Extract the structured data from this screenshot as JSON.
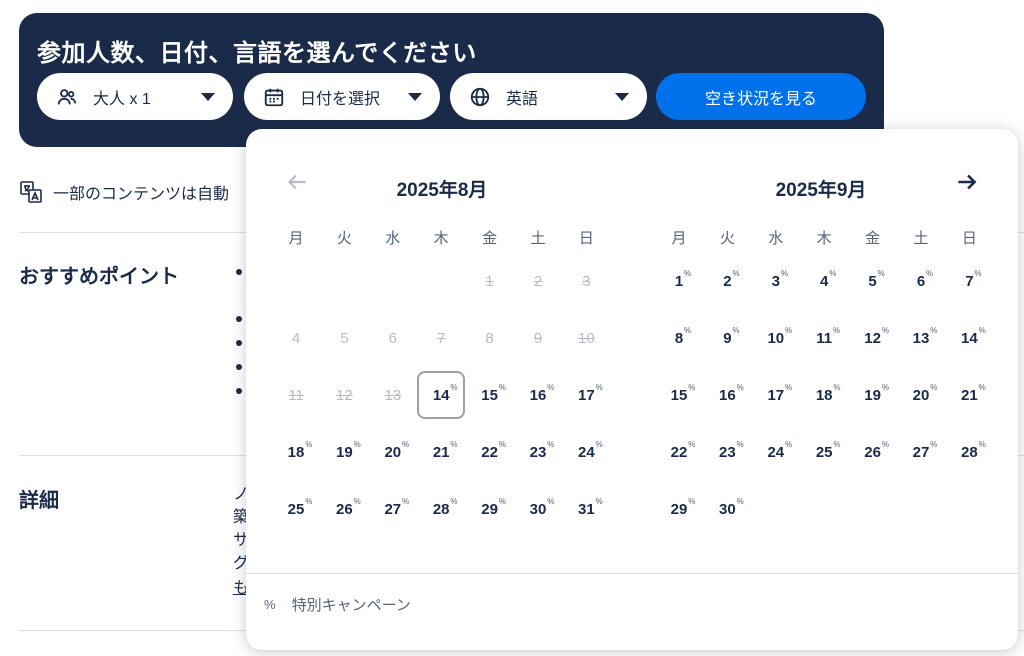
{
  "booking": {
    "title": "参加人数、日付、言語を選んでください",
    "participants_label": "大人 x 1",
    "date_label": "日付を選択",
    "language_label": "英語",
    "check_button": "空き状況を見る"
  },
  "content": {
    "translate_note": "一部のコンテンツは自動",
    "highlights_title": "おすすめポイント",
    "details_title": "詳細",
    "details_fragments": [
      "ノ",
      "築",
      "サ",
      "グ",
      "も"
    ]
  },
  "calendar": {
    "weekdays": [
      "月",
      "火",
      "水",
      "木",
      "金",
      "土",
      "日"
    ],
    "months": [
      {
        "title": "2025年8月",
        "rows": [
          [
            null,
            null,
            null,
            null,
            {
              "d": "1",
              "s": "disabled"
            },
            {
              "d": "2",
              "s": "disabled"
            },
            {
              "d": "3",
              "s": "disabled"
            }
          ],
          [
            {
              "d": "4",
              "s": "inactive"
            },
            {
              "d": "5",
              "s": "inactive"
            },
            {
              "d": "6",
              "s": "inactive"
            },
            {
              "d": "7",
              "s": "disabled"
            },
            {
              "d": "8",
              "s": "inactive"
            },
            {
              "d": "9",
              "s": "disabled"
            },
            {
              "d": "10",
              "s": "disabled"
            }
          ],
          [
            {
              "d": "11",
              "s": "disabled"
            },
            {
              "d": "12",
              "s": "disabled"
            },
            {
              "d": "13",
              "s": "disabled"
            },
            {
              "d": "14",
              "s": "selected"
            },
            {
              "d": "15",
              "s": "avail"
            },
            {
              "d": "16",
              "s": "avail"
            },
            {
              "d": "17",
              "s": "avail"
            }
          ],
          [
            {
              "d": "18",
              "s": "avail"
            },
            {
              "d": "19",
              "s": "avail"
            },
            {
              "d": "20",
              "s": "avail"
            },
            {
              "d": "21",
              "s": "avail"
            },
            {
              "d": "22",
              "s": "avail"
            },
            {
              "d": "23",
              "s": "avail"
            },
            {
              "d": "24",
              "s": "avail"
            }
          ],
          [
            {
              "d": "25",
              "s": "avail"
            },
            {
              "d": "26",
              "s": "avail"
            },
            {
              "d": "27",
              "s": "avail"
            },
            {
              "d": "28",
              "s": "avail"
            },
            {
              "d": "29",
              "s": "avail"
            },
            {
              "d": "30",
              "s": "avail"
            },
            {
              "d": "31",
              "s": "avail"
            }
          ]
        ]
      },
      {
        "title": "2025年9月",
        "rows": [
          [
            {
              "d": "1",
              "s": "avail"
            },
            {
              "d": "2",
              "s": "avail"
            },
            {
              "d": "3",
              "s": "avail"
            },
            {
              "d": "4",
              "s": "avail"
            },
            {
              "d": "5",
              "s": "avail"
            },
            {
              "d": "6",
              "s": "avail"
            },
            {
              "d": "7",
              "s": "avail"
            }
          ],
          [
            {
              "d": "8",
              "s": "avail"
            },
            {
              "d": "9",
              "s": "avail"
            },
            {
              "d": "10",
              "s": "avail"
            },
            {
              "d": "11",
              "s": "avail"
            },
            {
              "d": "12",
              "s": "avail"
            },
            {
              "d": "13",
              "s": "avail"
            },
            {
              "d": "14",
              "s": "avail"
            }
          ],
          [
            {
              "d": "15",
              "s": "avail"
            },
            {
              "d": "16",
              "s": "avail"
            },
            {
              "d": "17",
              "s": "avail"
            },
            {
              "d": "18",
              "s": "avail"
            },
            {
              "d": "19",
              "s": "avail"
            },
            {
              "d": "20",
              "s": "avail"
            },
            {
              "d": "21",
              "s": "avail"
            }
          ],
          [
            {
              "d": "22",
              "s": "avail"
            },
            {
              "d": "23",
              "s": "avail"
            },
            {
              "d": "24",
              "s": "avail"
            },
            {
              "d": "25",
              "s": "avail"
            },
            {
              "d": "26",
              "s": "avail"
            },
            {
              "d": "27",
              "s": "avail"
            },
            {
              "d": "28",
              "s": "avail"
            }
          ],
          [
            {
              "d": "29",
              "s": "avail"
            },
            {
              "d": "30",
              "s": "avail"
            },
            null,
            null,
            null,
            null,
            null
          ]
        ]
      }
    ],
    "promo_mark": "%",
    "legend_label": "特別キャンペーン"
  },
  "colors": {
    "navy": "#1a2b49",
    "primary": "#0071eb",
    "muted": "#b7bdc7"
  },
  "icons": [
    "people-icon",
    "calendar-icon",
    "globe-icon",
    "translate-icon",
    "arrow-left-icon",
    "arrow-right-icon"
  ]
}
